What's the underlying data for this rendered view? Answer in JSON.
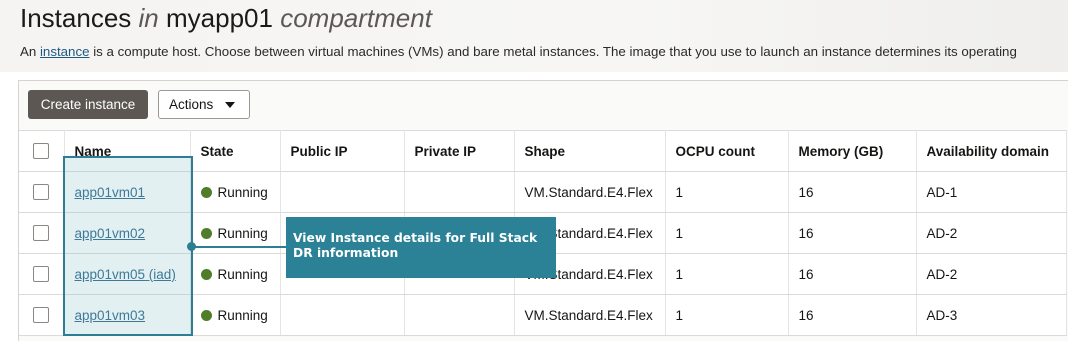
{
  "header": {
    "title_prefix": "Instances",
    "title_in": "in",
    "title_compartment": "myapp01",
    "title_suffix": "compartment",
    "desc_prefix": "An",
    "desc_link": "instance",
    "desc_rest": " is a compute host. Choose between virtual machines (VMs) and bare metal instances. The image that you use to launch an instance determines its operating"
  },
  "toolbar": {
    "create_label": "Create instance",
    "actions_label": "Actions"
  },
  "table": {
    "columns": [
      "Name",
      "State",
      "Public IP",
      "Private IP",
      "Shape",
      "OCPU count",
      "Memory (GB)",
      "Availability domain"
    ],
    "rows": [
      {
        "name": "app01vm01",
        "state": "Running",
        "public_ip": "",
        "private_ip": "",
        "shape": "VM.Standard.E4.Flex",
        "ocpu": "1",
        "memory": "16",
        "ad": "AD-1"
      },
      {
        "name": "app01vm02",
        "state": "Running",
        "public_ip": "",
        "private_ip": "",
        "shape": "VM.Standard.E4.Flex",
        "ocpu": "1",
        "memory": "16",
        "ad": "AD-2"
      },
      {
        "name": "app01vm05 (iad)",
        "state": "Running",
        "public_ip": "",
        "private_ip": "",
        "shape": "VM.Standard.E4.Flex",
        "ocpu": "1",
        "memory": "16",
        "ad": "AD-2"
      },
      {
        "name": "app01vm03",
        "state": "Running",
        "public_ip": "",
        "private_ip": "",
        "shape": "VM.Standard.E4.Flex",
        "ocpu": "1",
        "memory": "16",
        "ad": "AD-3"
      }
    ]
  },
  "callout": {
    "text": "View Instance details for Full Stack DR information"
  },
  "colors": {
    "running": "#4f7d29",
    "callout": "#2b8195",
    "link": "#1c5a82",
    "primary_button": "#5c5752"
  }
}
